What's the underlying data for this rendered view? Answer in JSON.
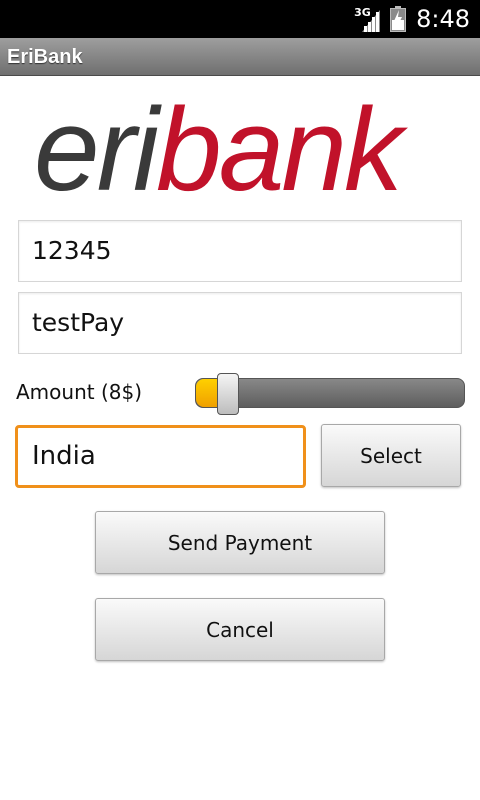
{
  "status_bar": {
    "network": "3G",
    "time": "8:48"
  },
  "app": {
    "title": "EriBank"
  },
  "logo": {
    "part1": "eri",
    "part2": "bank"
  },
  "form": {
    "account_value": "12345",
    "name_value": "testPay",
    "amount_label": "Amount (8$)",
    "amount_slider_fraction": 0.12,
    "country_value": "India",
    "select_label": "Select",
    "send_label": "Send Payment",
    "cancel_label": "Cancel"
  },
  "colors": {
    "logo_dark": "#3a3a3a",
    "logo_red": "#c1122a",
    "focus_orange": "#f0901a",
    "slider_yellow": "#ffc800"
  }
}
